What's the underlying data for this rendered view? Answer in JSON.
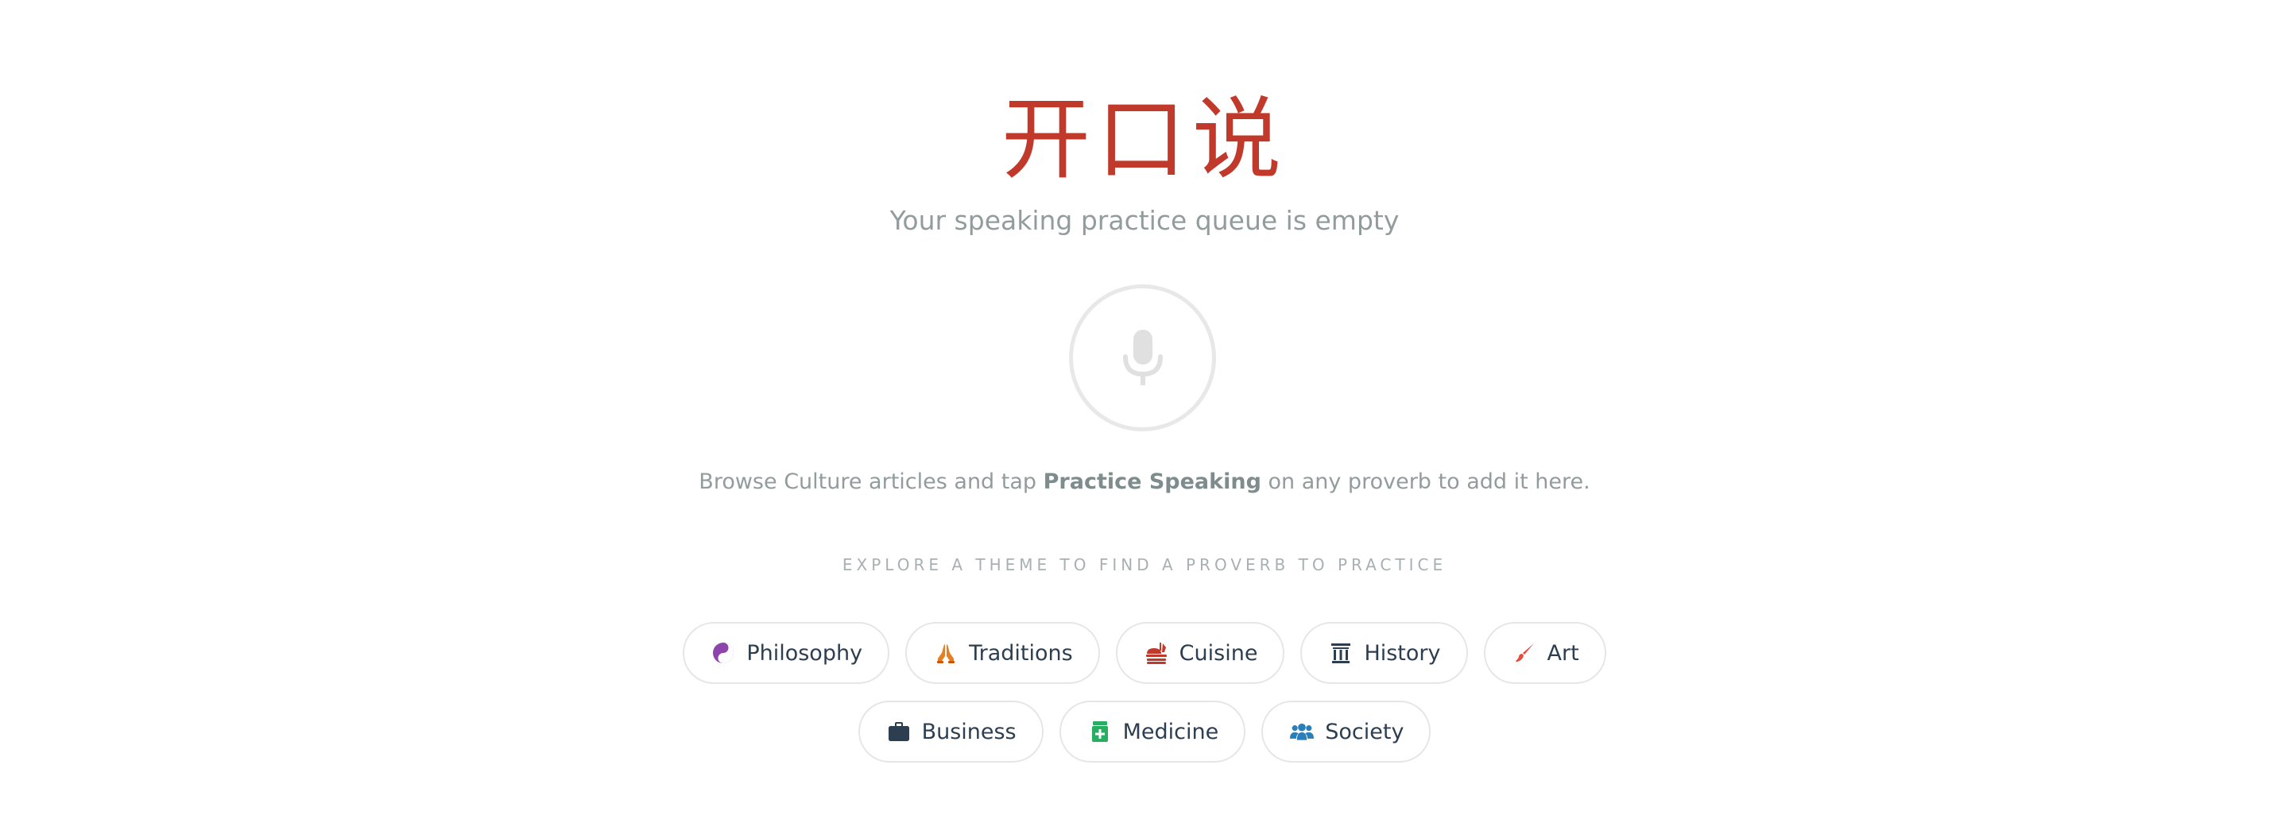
{
  "header": {
    "title": "开口说",
    "subtitle": "Your speaking practice queue is empty"
  },
  "empty_state": {
    "icon": "microphone-icon",
    "hint_before": "Browse Culture articles and tap ",
    "hint_emphasis": "Practice Speaking",
    "hint_after": " on any proverb to add it here."
  },
  "themes": {
    "label": "EXPLORE A THEME TO FIND A PROVERB TO PRACTICE",
    "items": [
      {
        "label": "Philosophy",
        "icon": "yin-yang-icon",
        "color": "#8e44ad"
      },
      {
        "label": "Traditions",
        "icon": "praying-hands-icon",
        "color": "#e67e22"
      },
      {
        "label": "Cuisine",
        "icon": "food-icon",
        "color": "#c0392b"
      },
      {
        "label": "History",
        "icon": "landmark-column-icon",
        "color": "#2c3e50"
      },
      {
        "label": "Art",
        "icon": "paintbrush-icon",
        "color": "#e74c3c"
      },
      {
        "label": "Business",
        "icon": "briefcase-icon",
        "color": "#2c3e50"
      },
      {
        "label": "Medicine",
        "icon": "medicine-bottle-icon",
        "color": "#27ae60"
      },
      {
        "label": "Society",
        "icon": "users-icon",
        "color": "#2980b9"
      }
    ]
  },
  "colors": {
    "accent": "#c0392b",
    "muted_text": "#939c9d",
    "chip_text": "#2c3e50",
    "chip_border": "#e4e6e7",
    "mic_circle": "#e8e8e8"
  }
}
